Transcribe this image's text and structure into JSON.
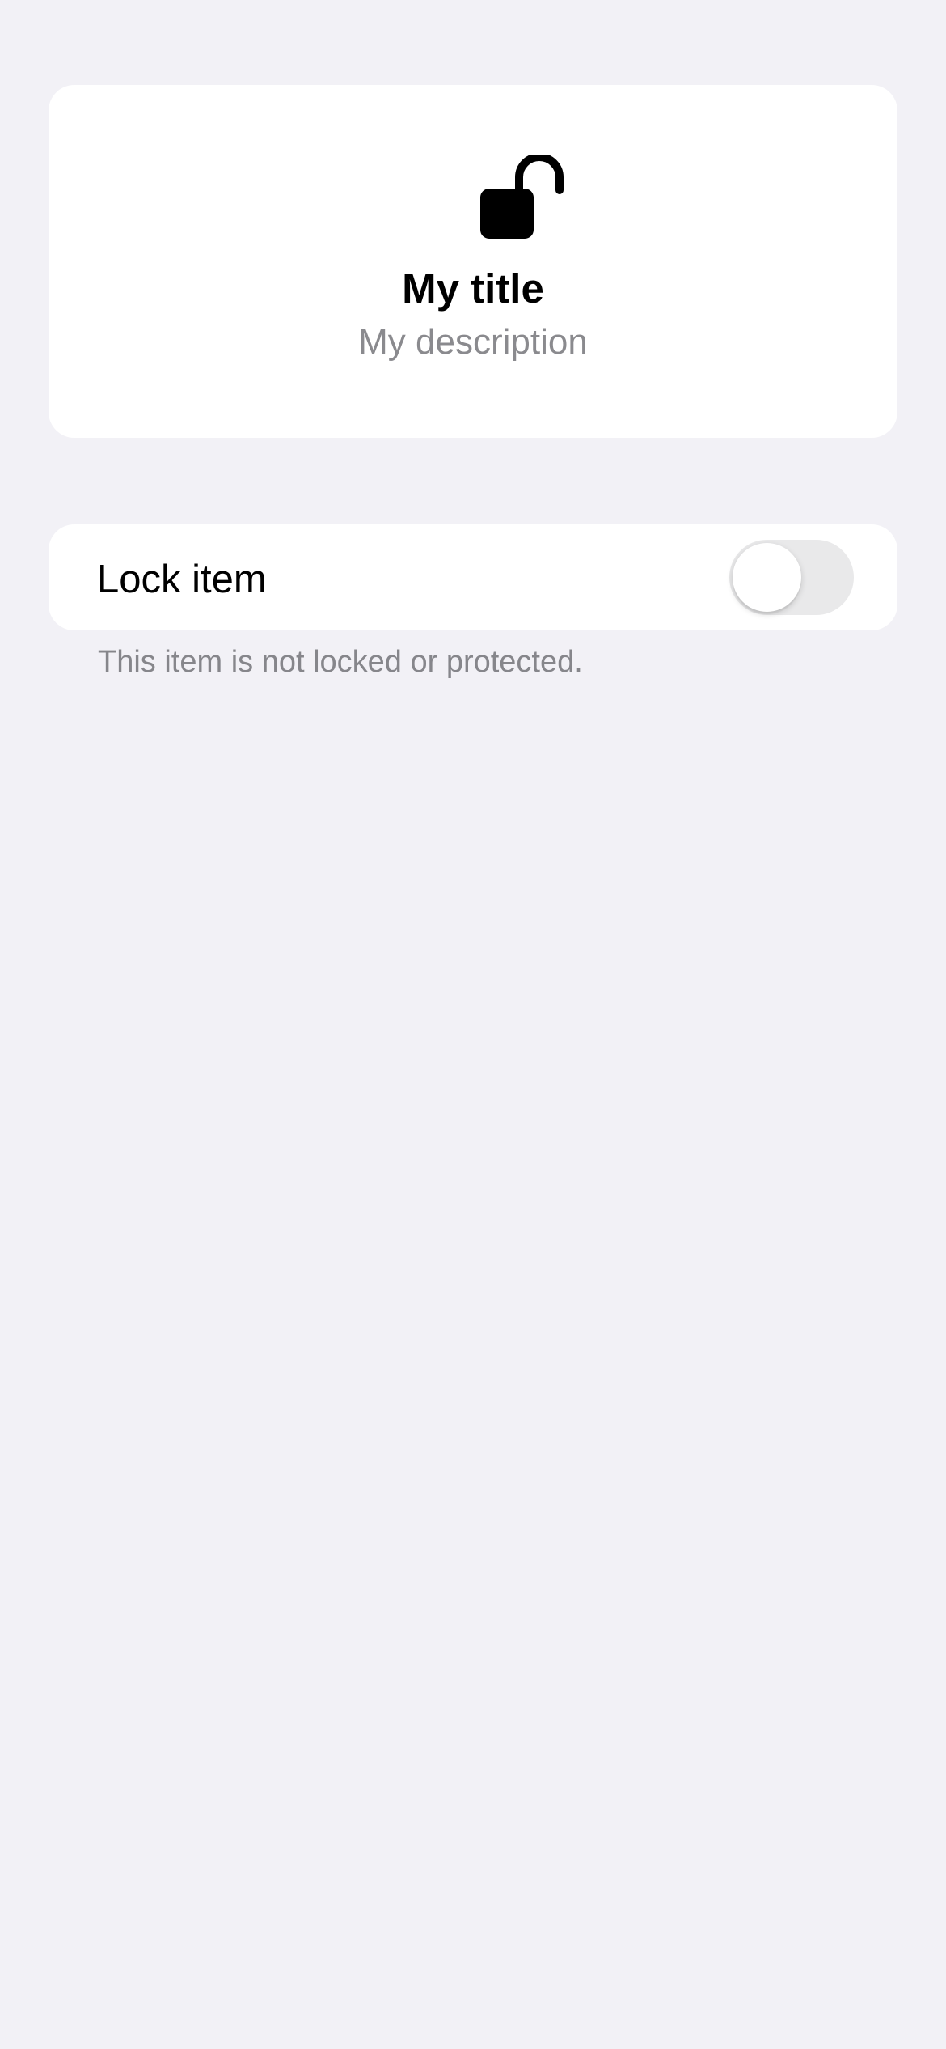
{
  "header": {
    "icon": "lock-open-icon",
    "title": "My title",
    "description": "My description"
  },
  "lock_setting": {
    "label": "Lock item",
    "enabled": false,
    "footer": "This item is not locked or protected."
  },
  "colors": {
    "background": "#F2F1F6",
    "card": "#FFFFFF",
    "secondary_text": "#8A8A8E",
    "switch_off": "#E9E9EA"
  }
}
